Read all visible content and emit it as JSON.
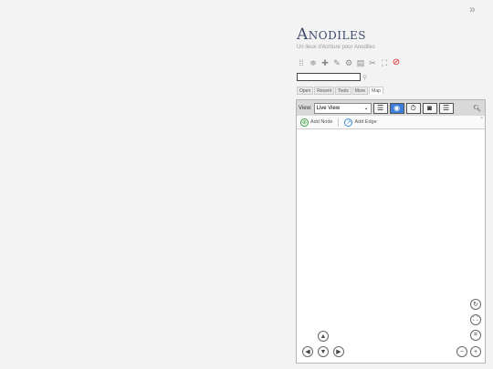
{
  "app": {
    "title": "Anodiles",
    "subtitle": "Un lieux d'écriture pour Anodiles",
    "expand_glyph": "»"
  },
  "toolbar": {
    "icons": [
      "grid-icon",
      "collapse-icon",
      "plus-icon",
      "wand-icon",
      "gear-icon",
      "document-icon",
      "tools-icon",
      "fullscreen-icon",
      "red-check-icon"
    ]
  },
  "search": {
    "value": "",
    "placeholder": ""
  },
  "tabs": [
    {
      "label": "Open"
    },
    {
      "label": "Recent"
    },
    {
      "label": "Tools"
    },
    {
      "label": "More"
    },
    {
      "label": "Map"
    }
  ],
  "active_tab": "Map",
  "view": {
    "label": "View:",
    "selected": "Live View"
  },
  "add_bar": {
    "add_node": "Add Node",
    "add_edge": "Add Edge",
    "close": "×"
  },
  "colors": {
    "title": "#3d4a6b",
    "accent": "#3d7fd8",
    "node_green": "#3aa142",
    "danger": "#d42020"
  }
}
